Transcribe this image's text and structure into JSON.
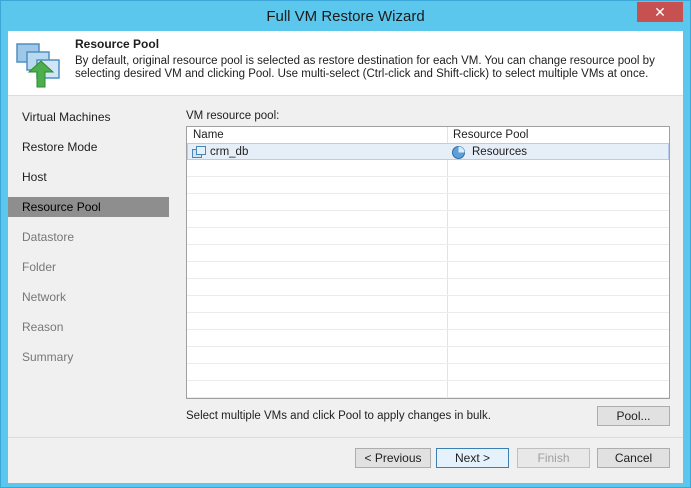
{
  "window": {
    "title": "Full VM Restore Wizard",
    "close_label": "✕"
  },
  "header": {
    "title": "Resource Pool",
    "description": "By default, original resource pool is selected as restore destination for each VM. You can change resource pool by selecting desired VM and clicking Pool. Use multi-select (Ctrl-click and Shift-click) to select multiple VMs at once."
  },
  "nav": {
    "items": [
      {
        "label": "Virtual Machines",
        "state": "done"
      },
      {
        "label": "Restore Mode",
        "state": "done"
      },
      {
        "label": "Host",
        "state": "done"
      },
      {
        "label": "Resource Pool",
        "state": "active"
      },
      {
        "label": "Datastore",
        "state": "pending"
      },
      {
        "label": "Folder",
        "state": "pending"
      },
      {
        "label": "Network",
        "state": "pending"
      },
      {
        "label": "Reason",
        "state": "pending"
      },
      {
        "label": "Summary",
        "state": "pending"
      }
    ]
  },
  "main": {
    "label": "VM resource pool:",
    "columns": [
      "Name",
      "Resource Pool"
    ],
    "rows": [
      {
        "name": "crm_db",
        "pool": "Resources",
        "selected": true
      }
    ],
    "hint": "Select multiple VMs and click Pool to apply changes in bulk.",
    "pool_button": "Pool..."
  },
  "footer": {
    "previous": "< Previous",
    "next": "Next >",
    "finish": "Finish",
    "cancel": "Cancel"
  },
  "colors": {
    "titlebar": "#5bc7ed",
    "close": "#c75050",
    "nav_active": "#8e8e8e",
    "row_selected": "#e6eef8"
  }
}
